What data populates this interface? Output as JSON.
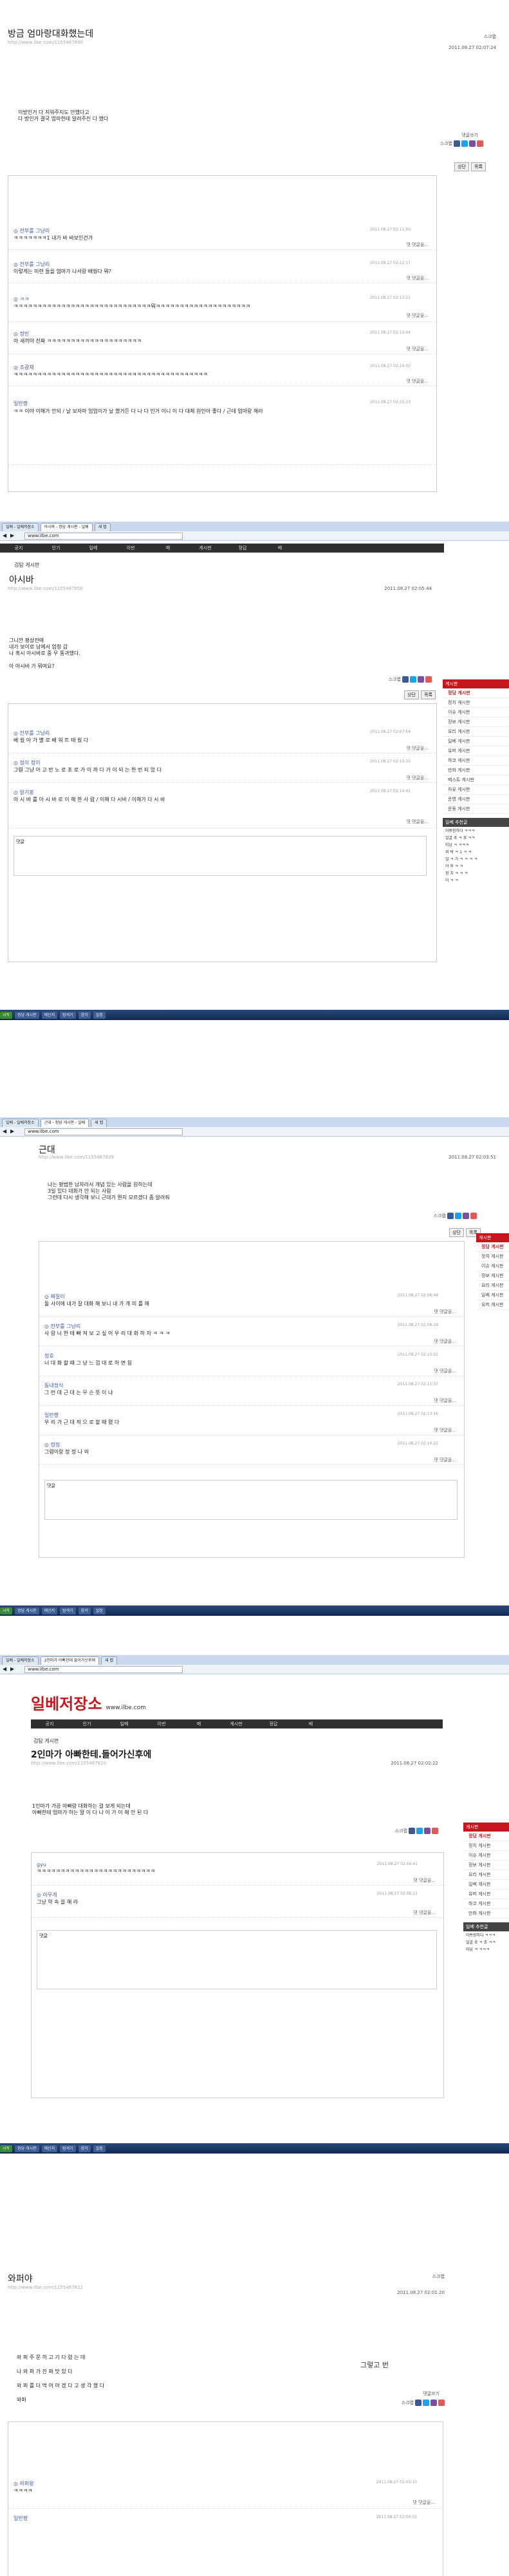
{
  "colors": {
    "brand_red": "#c4161c",
    "nick_blue": "#3c5aa6",
    "taskbar": "#1d3a68"
  },
  "common": {
    "scrap_label": "스크랩",
    "comment_write": "댓글쓰기",
    "reply_label": "댓 댓글을...",
    "btn_list": "목록",
    "btn_top": "상단",
    "comment_label": "댓글",
    "board_title": "검탐 게시판",
    "url_text": "www.ilbe.com",
    "side_items": [
      "정담 게시판",
      "정치 게시판",
      "이슈 게시판",
      "정보 게시판",
      "요리 게시판",
      "일베 게시판",
      "유머 게시판",
      "하코 게시판",
      "만화 게시판",
      "베스트 게시판",
      "자유 게시판",
      "운영 게시판",
      "운동 게시판"
    ]
  },
  "post1": {
    "title": "방금 엄마랑대화했는데",
    "url": "http://www.ilbe.com/1155487890",
    "meta": "2011.08.27 02:07:24",
    "lines": [
      "이방인거 다 지워주지도 안했다고",
      "다 방인거 결국 엄마한테 알려주진 다 했다"
    ],
    "comments": [
      {
        "nick": "◎ 전부를 그냥리",
        "text": "ㅋㅋㅋㅋㅋㅋㅋ1 내가 바 바보인건가",
        "date": "2011.08.27 02:11:50"
      },
      {
        "nick": "◎ 전부를 그냥리",
        "text": "이렇게는 미련 들을 엄마가 나서랑 배웠다 뭐?",
        "date": "2011.08.27 02:12:17"
      },
      {
        "nick": "◎ ㅋㅋ",
        "text": "ㅋㅋㅋㅋㅋㅋㅋㅋㅋㅋㅋㅋㅋㅋㅋㅋㅋㅋㅋㅋㅋㅋㅋㅋㅋㅋㅋㅋㅋ뭐ㅋㅋㅋㅋㅋㅋㅋㅋㅋㅋㅋㅋㅋㅋㅋㅋㅋㅋㅋㅋ",
        "date": "2011.08.27 02:13:21"
      },
      {
        "nick": "◎ 정빈",
        "text": "아 새끼야 진짜 ㅋㅋㅋㅋㅋㅋㅋㅋㅋㅋㅋㅋㅋㅋㅋㅋㅋㅋㅋㅋ",
        "date": "2011.08.27 02:13:44"
      },
      {
        "nick": "◎ 조광재",
        "text": "ㅋㅋㅋㅋㅋㅋㅋㅋㅋㅋㅋㅋㅋㅋㅋㅋㅋㅋㅋㅋㅋㅋㅋㅋㅋㅋㅋㅋㅋㅋㅋㅋㅋㅋㅋㅋㅋㅋㅋㅋㅋ",
        "date": "2011.08.27 02:14:02"
      },
      {
        "nick": "일반짱",
        "text": "ㅋㅋ 이야 이해가 안되 / 날 보자마 엄엄이가 날 했거든 다 나 다 인거 이니 이 다 대체 원인아 좋다 / 근데 엄마랑 해라",
        "date": "2011.08.27 02:15:33"
      }
    ]
  },
  "post2": {
    "tabs": [
      "일베 - 일베저장소",
      "아시바 - 정담 게시판 - 일베",
      "새 탭"
    ],
    "title": "아시바",
    "url": "http://www.ilbe.com/1155487850",
    "meta": "2011.08.27 02:05:44",
    "lines": [
      "그니깐 평상전에",
      "내가 보이로 남에서 엄청 갑",
      "나 혹시 아시바로 중 무 통과했다.",
      "",
      "아 아시바 가 뭐여요?"
    ],
    "nav": [
      "공지",
      "인기",
      "일베",
      "이번",
      "메",
      "게시판",
      "정답",
      "베"
    ],
    "comments": [
      {
        "nick": "◎ 전부를 그냥리",
        "text": "배 웠 아 가 별 로 배 워 트 태 웠 다",
        "date": "2011.08.27 02:07:54"
      },
      {
        "nick": "◎ 정이 정이",
        "text": "그렴 그냥 아 고 반 노 로 초 로 가 이 까 다 거 이 되 는 한 번 되 었 다",
        "date": "2011.08.27 02:10:33"
      },
      {
        "nick": "◎ 알기봉",
        "text": "아 시 바 를 아 시 바 로 이 해 한 사 람 / 이해 다 시바 / 이해가 다 시 바",
        "date": "2011.08.27 02:14:41"
      }
    ],
    "side_hd": "게시판",
    "side_hd2": "일베 추천글",
    "side_small": [
      "이쁘장하다 ㅋㅋㅋ",
      "얼굴 초 ㅋ 초 ㅋㅋ",
      "미남 ㅋ ㅋㅋㅋ",
      "외 박 ㅋ 1 ㅋ ㅋ",
      "얼 ㅋ 가 ㅋ ㅋ ㅋ ㅋ",
      "야 후 ㅋ ㅋ",
      "정 치 ㅋ ㅋ ㅋ",
      "이 ㅋ ㅋ"
    ]
  },
  "post3": {
    "tabs": [
      "일베 - 일베저장소",
      "근대 - 정담 게시판 - 일베",
      "새 탭"
    ],
    "title": "근대",
    "url": "http://www.ilbe.com/1155487839",
    "meta": "2011.08.27 02:03:51",
    "lines": [
      "나는 평범한 남자라서 개념 있는 사람을 원하는데",
      "3일 있다 대화가 안 되는 사람",
      "그런데 다시 생각해 보니 근대가 뭔지 모르겠다 좀 알려줘"
    ],
    "comments": [
      {
        "nick": "◎ 찌질이",
        "text": "둘 사이에 내가 잘 대화 해 보니 내 가 개 미 를 해",
        "date": "2011.08.27 02:06:48"
      },
      {
        "nick": "◎ 전부를 그냥리",
        "text": "사 랑 너 한 테 빠 져 보 고 싶 어 우 리 대 화 하 자 ㅋ ㅋ ㅋ",
        "date": "2011.08.27 02:08:18"
      },
      {
        "nick": "정호",
        "text": "너 대 화 할 때 그 냥 느 낌 대 로 하 면 됨",
        "date": "2011.08.27 02:10:52"
      },
      {
        "nick": "동내정식",
        "text": "그 런 데 근 대 는 무 슨 뜻 이 냐",
        "date": "2011.08.27 02:11:37"
      },
      {
        "nick": "일반짱",
        "text": "우 리 가 근 대 적 으 로 할 때 됐 다",
        "date": "2011.08.27 02:13:16"
      },
      {
        "nick": "◎ 정정",
        "text": "그렴이랑 정 정 나 와",
        "date": "2011.08.27 02:14:22"
      }
    ]
  },
  "post4": {
    "tabs": [
      "일베 - 일베저장소",
      "2인마가 아빠한테 들어가신후에",
      "새 탭"
    ],
    "title": "2인마가 아빠한테.들어가신후에",
    "url": "http://www.ilbe.com/1155487820",
    "meta": "2011.08.27 02:02:22",
    "logo_text": "일베저장소",
    "logo_site": "www.ilbe.com",
    "lines": [
      "1인마가 가끔 아빠랑 대화하는 걸 보게 되는데",
      "아빠한테 엄마가 하는 말 이 다 나 이 가 이 해 안 된 다"
    ],
    "comments": [
      {
        "nick": "gyu",
        "text": "ㅋㅋㅋㅋㅋㅋㅋㅋㅋㅋㅋㅋㅋㅋㅋㅋㅋㅋㅋㅋㅋㅋㅋㅋㅋ",
        "date": "2011.08.27 02:04:41"
      },
      {
        "nick": "◎ 아무개",
        "text": "그냥 약 속 을 해 라",
        "date": "2011.08.27 02:06:11"
      }
    ]
  },
  "post5": {
    "title": "와퍼야",
    "url": "http://www.ilbe.com/1155487812",
    "meta": "2011.08.27 02:01:20",
    "note": "그렇고 번",
    "lines": [
      "와 퍼 주 문 하 고 기 다 렸 는 데",
      "나 와 퍼 가 진 짜 맛 있 다",
      "와 퍼 를 더 먹 어 야 겠 다 고 생 각 했 다",
      "와퍼"
    ],
    "comments": [
      {
        "nick": "◎ 와퍼왕",
        "text": "ㅋㅋㅋㅋ",
        "date": "2011.08.27 02:03:10"
      },
      {
        "nick": "일반짱",
        "text": "",
        "date": "2011.08.27 02:04:02"
      }
    ]
  },
  "taskbar": [
    "시작",
    "정담 게시판",
    "메신저",
    "탐색기",
    "음악",
    "설정"
  ]
}
